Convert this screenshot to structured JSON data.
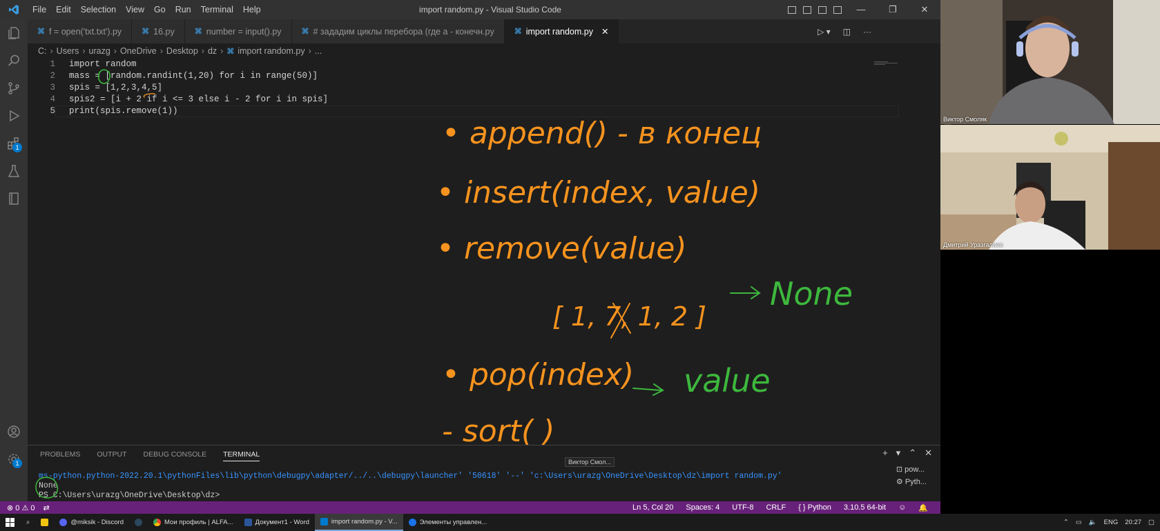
{
  "window": {
    "title": "import random.py - Visual Studio Code",
    "menu": [
      "File",
      "Edit",
      "Selection",
      "View",
      "Go",
      "Run",
      "Terminal",
      "Help"
    ]
  },
  "tabs": [
    {
      "label": "f = open('txt.txt').py",
      "active": false
    },
    {
      "label": "16.py",
      "active": false
    },
    {
      "label": "number = input().py",
      "active": false
    },
    {
      "label": "# зададим циклы перебора (где a - конечн.py",
      "active": false
    },
    {
      "label": "import random.py",
      "active": true
    }
  ],
  "breadcrumb": [
    "C:",
    "Users",
    "urazg",
    "OneDrive",
    "Desktop",
    "dz",
    "import random.py",
    "..."
  ],
  "editor": {
    "line_numbers": [
      "1",
      "2",
      "3",
      "4",
      "5"
    ],
    "lines": [
      "import random",
      "mass = [random.randint(1,20) for i in range(50)]",
      "spis = [1,2,3,4,5]",
      "spis2 = [i + 2 if i <= 3 else i - 2 for i in spis]",
      "print(spis.remove(1))"
    ]
  },
  "handwriting": {
    "items": [
      "• append() - в конец",
      "• insert(index, value)",
      "• remove(value)",
      "[ 1, 7, 1, 2 ]",
      "None",
      "• pop(index)",
      "value",
      "- sort( )"
    ],
    "colors": {
      "orange": "#f7931e",
      "green": "#3db83d"
    }
  },
  "panel": {
    "tabs": [
      "PROBLEMS",
      "OUTPUT",
      "DEBUG CONSOLE",
      "TERMINAL"
    ],
    "active_tab": "TERMINAL",
    "terminal_lines": [
      "ms-python.python-2022.20.1\\pythonFiles\\lib\\python\\debugpy\\adapter/../..\\debugpy\\launcher' '50618' '--' 'c:\\Users\\urazg\\OneDrive\\Desktop\\dz\\import random.py'",
      "None",
      "PS C:\\Users\\urazg\\OneDrive\\Desktop\\dz>"
    ],
    "terminal_list": [
      "pow...",
      "Pyth..."
    ],
    "tooltip": "Виктор Смол..."
  },
  "statusbar": {
    "errors": "0",
    "warnings": "0",
    "position": "Ln 5, Col 20",
    "spaces": "Spaces: 4",
    "encoding": "UTF-8",
    "eol": "CRLF",
    "language": "Python",
    "interpreter": "3.10.5 64-bit",
    "color": "#68217a"
  },
  "participants": [
    {
      "name": "Виктор Смоляк"
    },
    {
      "name": "Дмитрий Уразгалиев"
    }
  ],
  "taskbar": {
    "apps": [
      {
        "label": "@miksik - Discord",
        "color": "#5865f2"
      },
      {
        "label": "",
        "color": "#1b2838"
      },
      {
        "label": "Мои профиль | ALFA...",
        "color": "#e94235"
      },
      {
        "label": "Документ1 - Word",
        "color": "#2b579a"
      },
      {
        "label": "import random.py - V...",
        "color": "#007acc",
        "active": true
      },
      {
        "label": "Элементы управлен...",
        "color": "#1a73e8"
      }
    ],
    "lang": "ENG",
    "time": "20:27"
  }
}
